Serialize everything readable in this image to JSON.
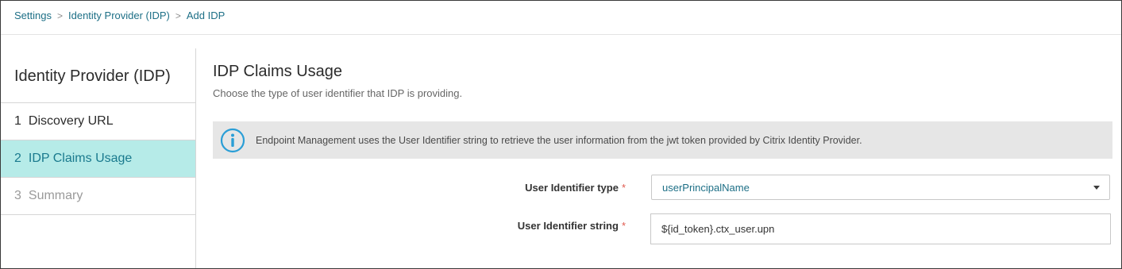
{
  "breadcrumb": {
    "items": [
      "Settings",
      "Identity Provider (IDP)",
      "Add IDP"
    ],
    "separator": ">"
  },
  "wizard": {
    "title": "Identity Provider (IDP)",
    "steps": [
      {
        "num": "1",
        "label": "Discovery URL",
        "state": "done"
      },
      {
        "num": "2",
        "label": "IDP Claims Usage",
        "state": "active"
      },
      {
        "num": "3",
        "label": "Summary",
        "state": "pending"
      }
    ]
  },
  "main": {
    "title": "IDP Claims Usage",
    "subtitle": "Choose the type of user identifier that IDP is providing.",
    "info": {
      "icon": "info-icon",
      "text": "Endpoint Management uses the User Identifier string to retrieve the user information from the jwt token provided by Citrix Identity Provider."
    },
    "form": {
      "identifier_type": {
        "label": "User Identifier type",
        "required_mark": "*",
        "value": "userPrincipalName"
      },
      "identifier_string": {
        "label": "User Identifier string",
        "required_mark": "*",
        "value": "${id_token}.ctx_user.upn"
      }
    }
  },
  "colors": {
    "link": "#1d6f86",
    "active_step_bg": "#b6ebe8",
    "info_icon": "#2a9ed6",
    "required": "#e05a4f",
    "banner_bg": "#e6e6e6"
  }
}
